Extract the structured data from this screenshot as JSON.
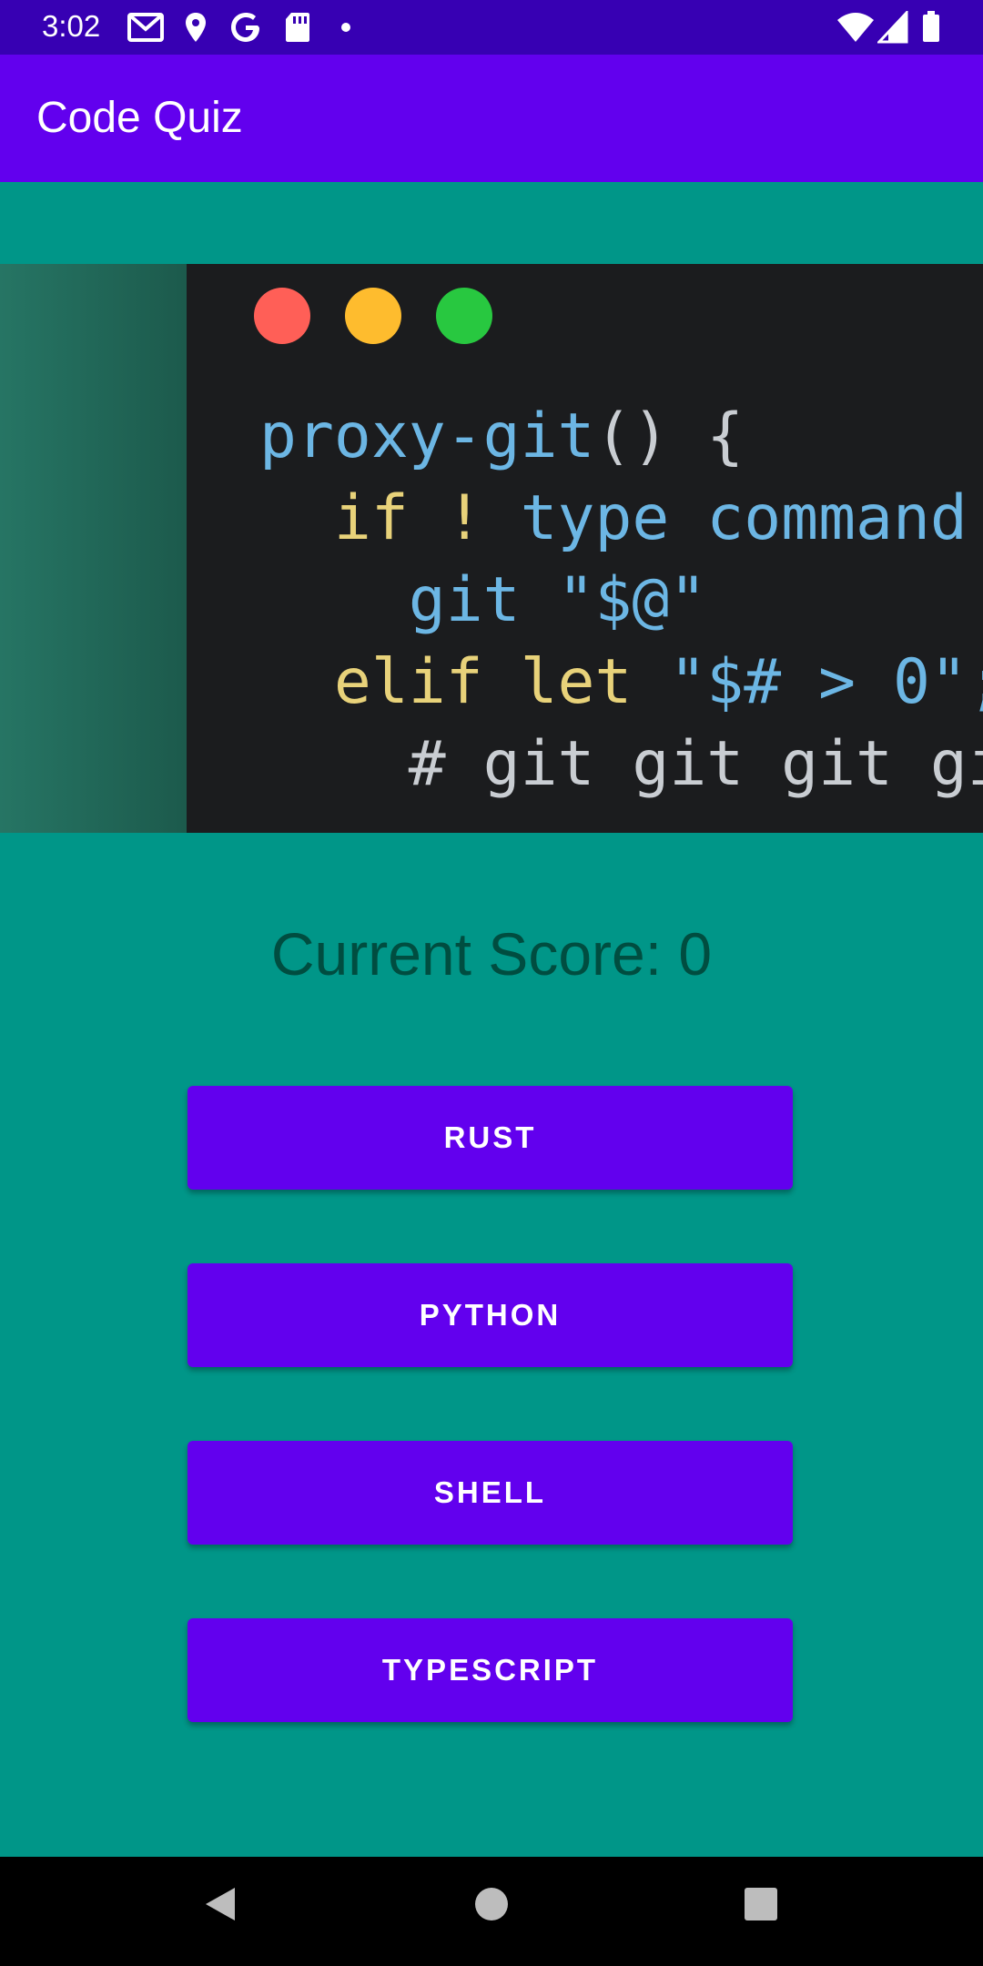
{
  "status_bar": {
    "time": "3:02",
    "icons_left": [
      "gmail-icon",
      "location-pin-icon",
      "google-icon",
      "sd-card-icon",
      "notification-dot-icon"
    ],
    "icons_right": [
      "wifi-icon",
      "signal-icon",
      "battery-icon"
    ]
  },
  "app_bar": {
    "title": "Code Quiz",
    "color": "#6200EE"
  },
  "code_image": {
    "lines": [
      {
        "parts": [
          {
            "text": "proxy-git",
            "cls": "c-blue"
          },
          {
            "text": "() {",
            "cls": "c-white"
          }
        ]
      },
      {
        "parts": [
          {
            "text": "  if ! ",
            "cls": "c-yellow"
          },
          {
            "text": "type command ",
            "cls": "c-blue"
          }
        ]
      },
      {
        "parts": [
          {
            "text": "    git \"$@\"",
            "cls": "c-blue"
          }
        ]
      },
      {
        "parts": [
          {
            "text": "  elif let ",
            "cls": "c-yellow"
          },
          {
            "text": "\"$# > 0\";",
            "cls": "c-blue"
          }
        ]
      },
      {
        "parts": [
          {
            "text": "    # git git git gi",
            "cls": "c-white"
          }
        ]
      }
    ]
  },
  "score": {
    "text": "Current Score: 0"
  },
  "answers": [
    {
      "label": "RUST"
    },
    {
      "label": "PYTHON"
    },
    {
      "label": "SHELL"
    },
    {
      "label": "TYPESCRIPT"
    }
  ],
  "nav_bar": {
    "buttons": [
      "back-icon",
      "home-icon",
      "recents-icon"
    ]
  },
  "colors": {
    "background": "#009688",
    "status_bar": "#3700B3",
    "button": "#6200EE"
  }
}
